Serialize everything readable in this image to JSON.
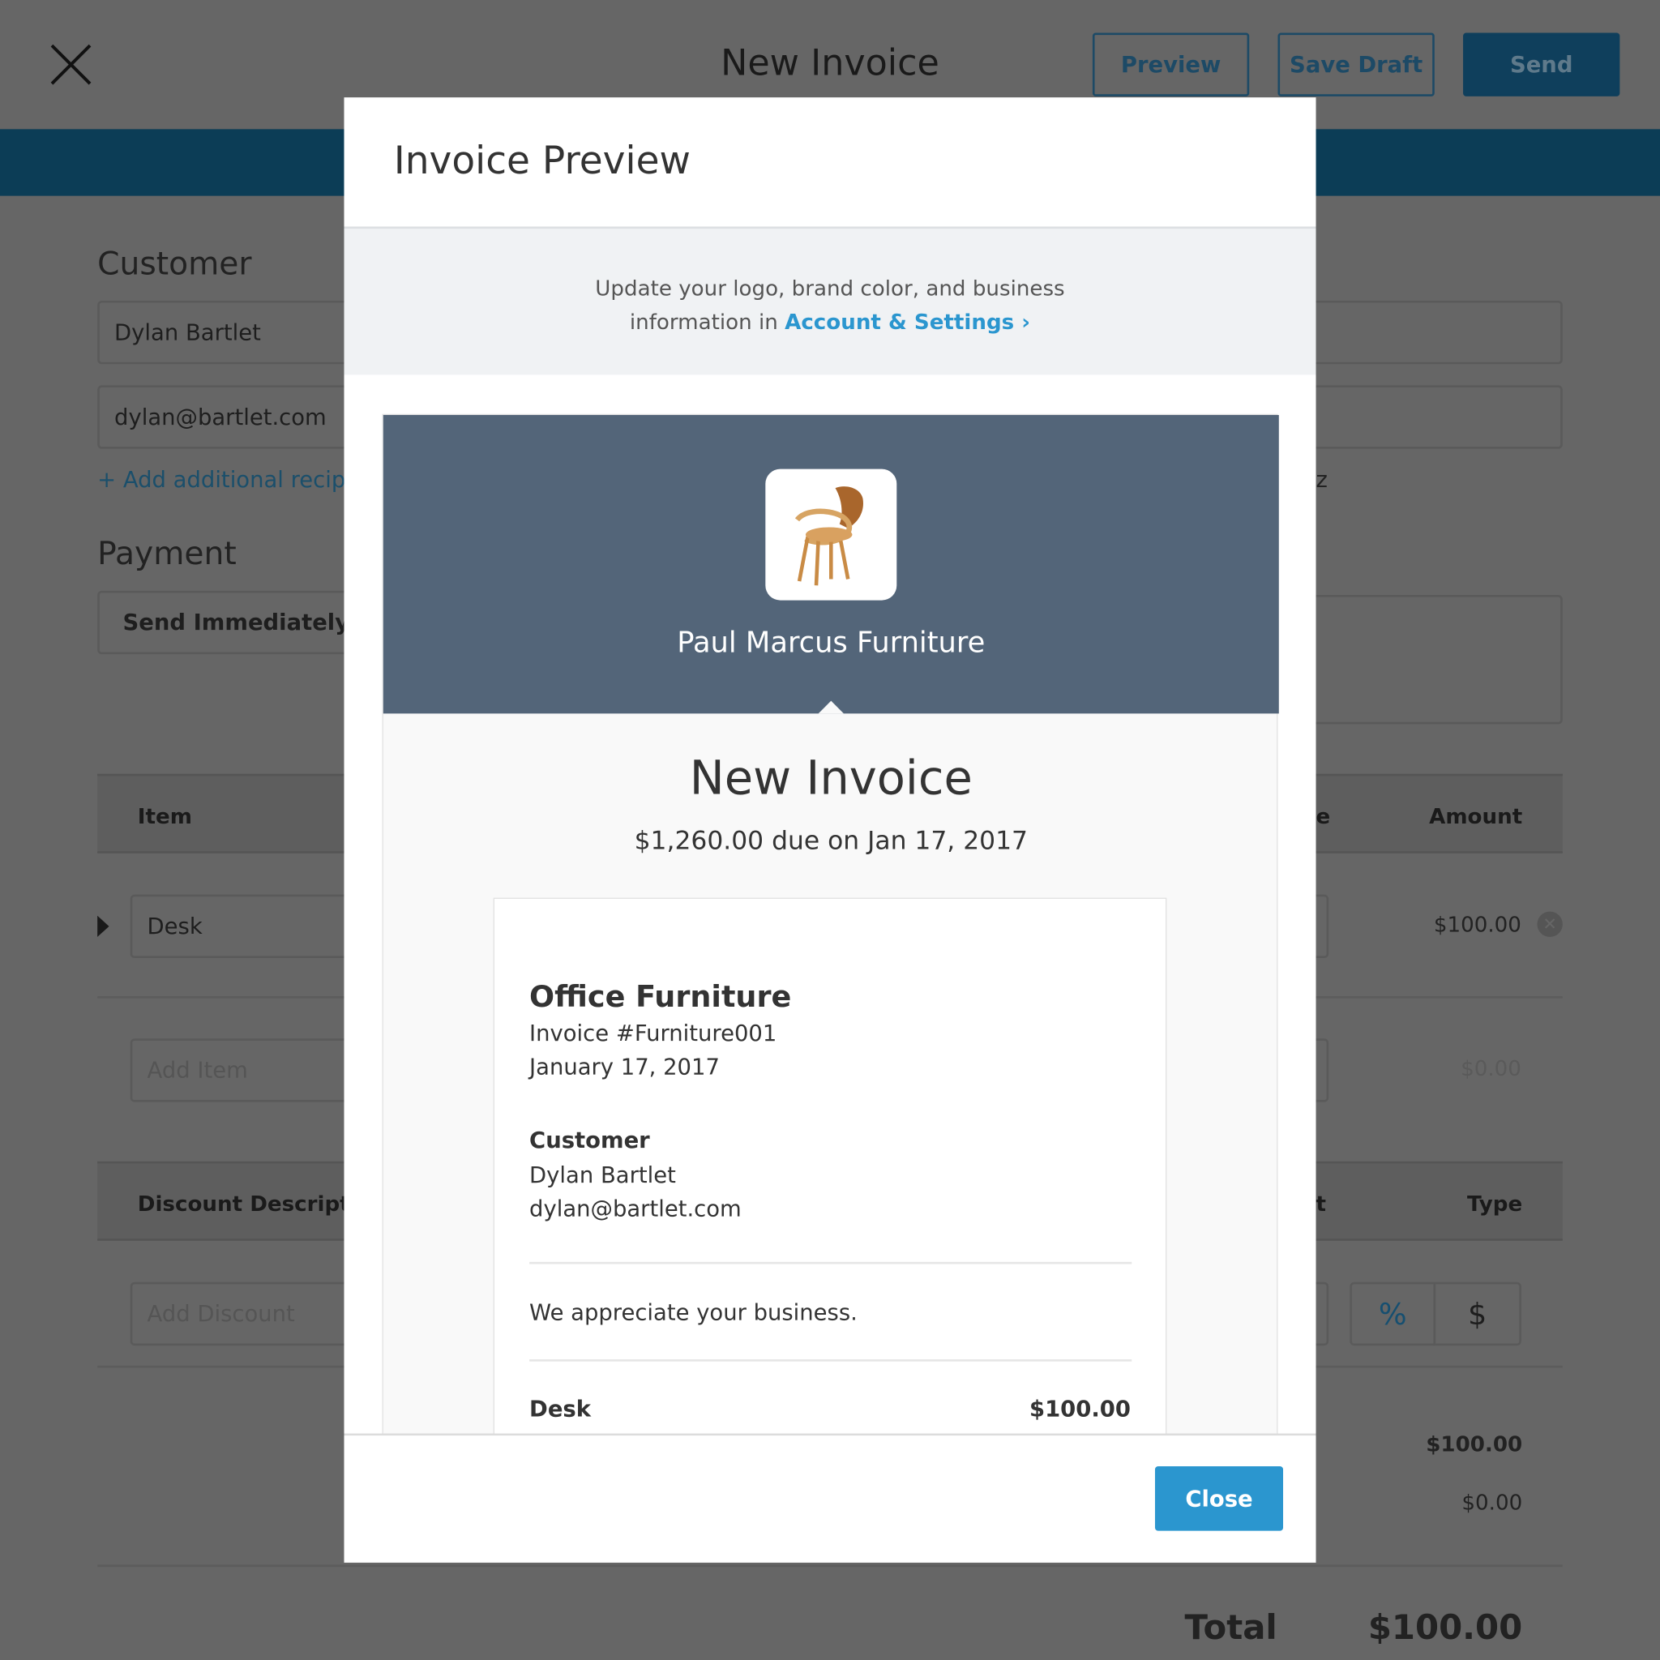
{
  "header": {
    "title": "New Invoice",
    "close_icon": "close-x-icon",
    "preview_label": "Preview",
    "save_draft_label": "Save Draft",
    "send_label": "Send"
  },
  "form": {
    "customer_heading": "Customer",
    "customer_name": "Dylan Bartlet",
    "customer_email": "dylan@bartlet.com",
    "add_recipient": "+ Add additional recipie",
    "right_partial": "z",
    "payment_heading": "Payment",
    "payment_value": "Send Immediately",
    "items_header": {
      "item": "Item",
      "partial": "e",
      "amount": "Amount"
    },
    "item_row": {
      "name": "Desk",
      "amount": "$100.00"
    },
    "add_item_placeholder": "Add Item",
    "add_item_amount": "$0.00",
    "discount_header": {
      "description": "Discount Descriptio",
      "partial": "t",
      "type": "Type"
    },
    "add_discount_placeholder": "Add Discount",
    "type_percent": "%",
    "type_dollar": "$",
    "subtotal": "$100.00",
    "discount_total": "$0.00",
    "total_label": "Total",
    "total_value": "$100.00"
  },
  "modal": {
    "title": "Invoice Preview",
    "banner_line1": "Update your logo, brand color, and business",
    "banner_line2": "information in ",
    "banner_link": "Account & Settings",
    "banner_link_chevron": "›",
    "business_name": "Paul Marcus Furniture",
    "brand_color": "#536579",
    "invoice_title": "New Invoice",
    "due_text": "$1,260.00 due on Jan 17, 2017",
    "card": {
      "title": "Office Furniture",
      "invoice_number": "Invoice #Furniture001",
      "date": "January 17, 2017",
      "customer_label": "Customer",
      "customer_name": "Dylan Bartlet",
      "customer_email": "dylan@bartlet.com",
      "message": "We appreciate your business.",
      "line_item": {
        "name": "Desk",
        "amount": "$100.00"
      }
    },
    "close_label": "Close",
    "accent": "#2b96cf"
  }
}
